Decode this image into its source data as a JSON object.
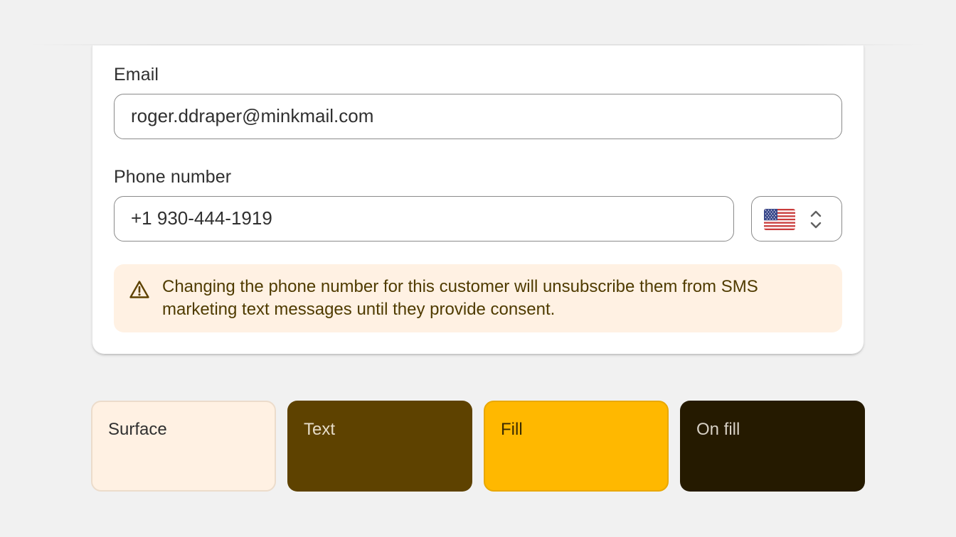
{
  "form": {
    "email": {
      "label": "Email",
      "value": "roger.ddraper@minkmail.com"
    },
    "phone": {
      "label": "Phone number",
      "value": "+1 930-444-1919",
      "country_flag": "us-flag-icon"
    }
  },
  "banner": {
    "icon": "warning-icon",
    "message": "Changing the phone number for this customer will unsubscribe them from SMS marketing text messages until they provide consent."
  },
  "swatches": [
    {
      "label": "Surface",
      "color": "#fff1e3"
    },
    {
      "label": "Text",
      "color": "#5e4200"
    },
    {
      "label": "Fill",
      "color": "#ffb800"
    },
    {
      "label": "On fill",
      "color": "#251a00"
    }
  ]
}
